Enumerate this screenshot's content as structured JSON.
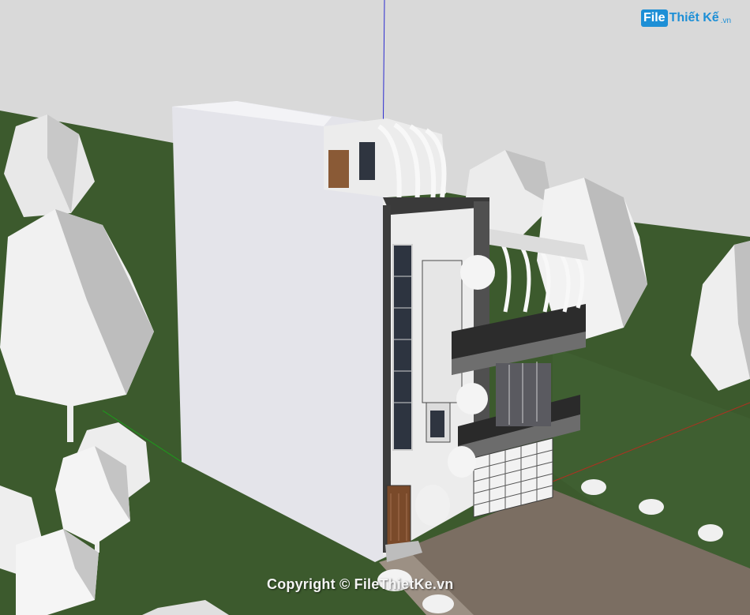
{
  "watermark": {
    "logo_box": "File",
    "logo_text": "Thiết Kế",
    "logo_suffix": ".vn",
    "copyright": "Copyright © FileThietKe.vn"
  },
  "colors": {
    "sky": "#d8d8d8",
    "grass": "#3d5a2e",
    "wall": "#e6e6ec",
    "road": "#7a6d60",
    "logo": "#1d8fd6"
  }
}
